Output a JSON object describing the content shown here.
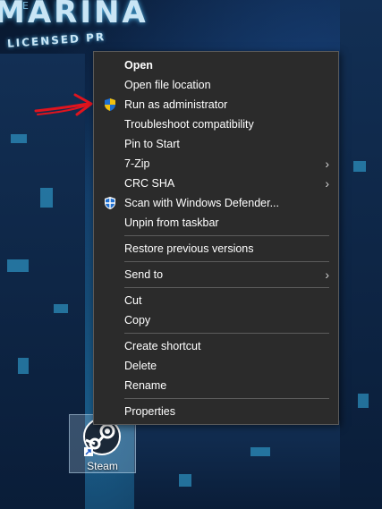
{
  "desktop": {
    "sign": {
      "title": "MARINA",
      "subtitle": "LICENSED PR",
      "top_text": "E"
    },
    "icons": [
      {
        "label": "Steam"
      }
    ]
  },
  "context_menu": {
    "groups": [
      [
        {
          "label": "Open",
          "bold": true,
          "icon": null,
          "submenu": false
        },
        {
          "label": "Open file location",
          "icon": null,
          "submenu": false
        },
        {
          "label": "Run as administrator",
          "icon": "uac-shield-icon",
          "submenu": false
        },
        {
          "label": "Troubleshoot compatibility",
          "icon": null,
          "submenu": false
        },
        {
          "label": "Pin to Start",
          "icon": null,
          "submenu": false
        },
        {
          "label": "7-Zip",
          "icon": null,
          "submenu": true
        },
        {
          "label": "CRC SHA",
          "icon": null,
          "submenu": true
        },
        {
          "label": "Scan with Windows Defender...",
          "icon": "windows-defender-icon",
          "submenu": false
        },
        {
          "label": "Unpin from taskbar",
          "icon": null,
          "submenu": false
        }
      ],
      [
        {
          "label": "Restore previous versions",
          "icon": null,
          "submenu": false
        }
      ],
      [
        {
          "label": "Send to",
          "icon": null,
          "submenu": true
        }
      ],
      [
        {
          "label": "Cut",
          "icon": null,
          "submenu": false
        },
        {
          "label": "Copy",
          "icon": null,
          "submenu": false
        }
      ],
      [
        {
          "label": "Create shortcut",
          "icon": null,
          "submenu": false
        },
        {
          "label": "Delete",
          "icon": null,
          "submenu": false
        },
        {
          "label": "Rename",
          "icon": null,
          "submenu": false
        }
      ],
      [
        {
          "label": "Properties",
          "icon": null,
          "submenu": false
        }
      ]
    ]
  },
  "colors": {
    "menu_bg": "#2b2b2b",
    "menu_text": "#ffffff",
    "separator": "#5c5c5c",
    "annotation_arrow": "#e0141e",
    "shield_blue": "#1e6fd0",
    "shield_yellow": "#f2c10f"
  }
}
